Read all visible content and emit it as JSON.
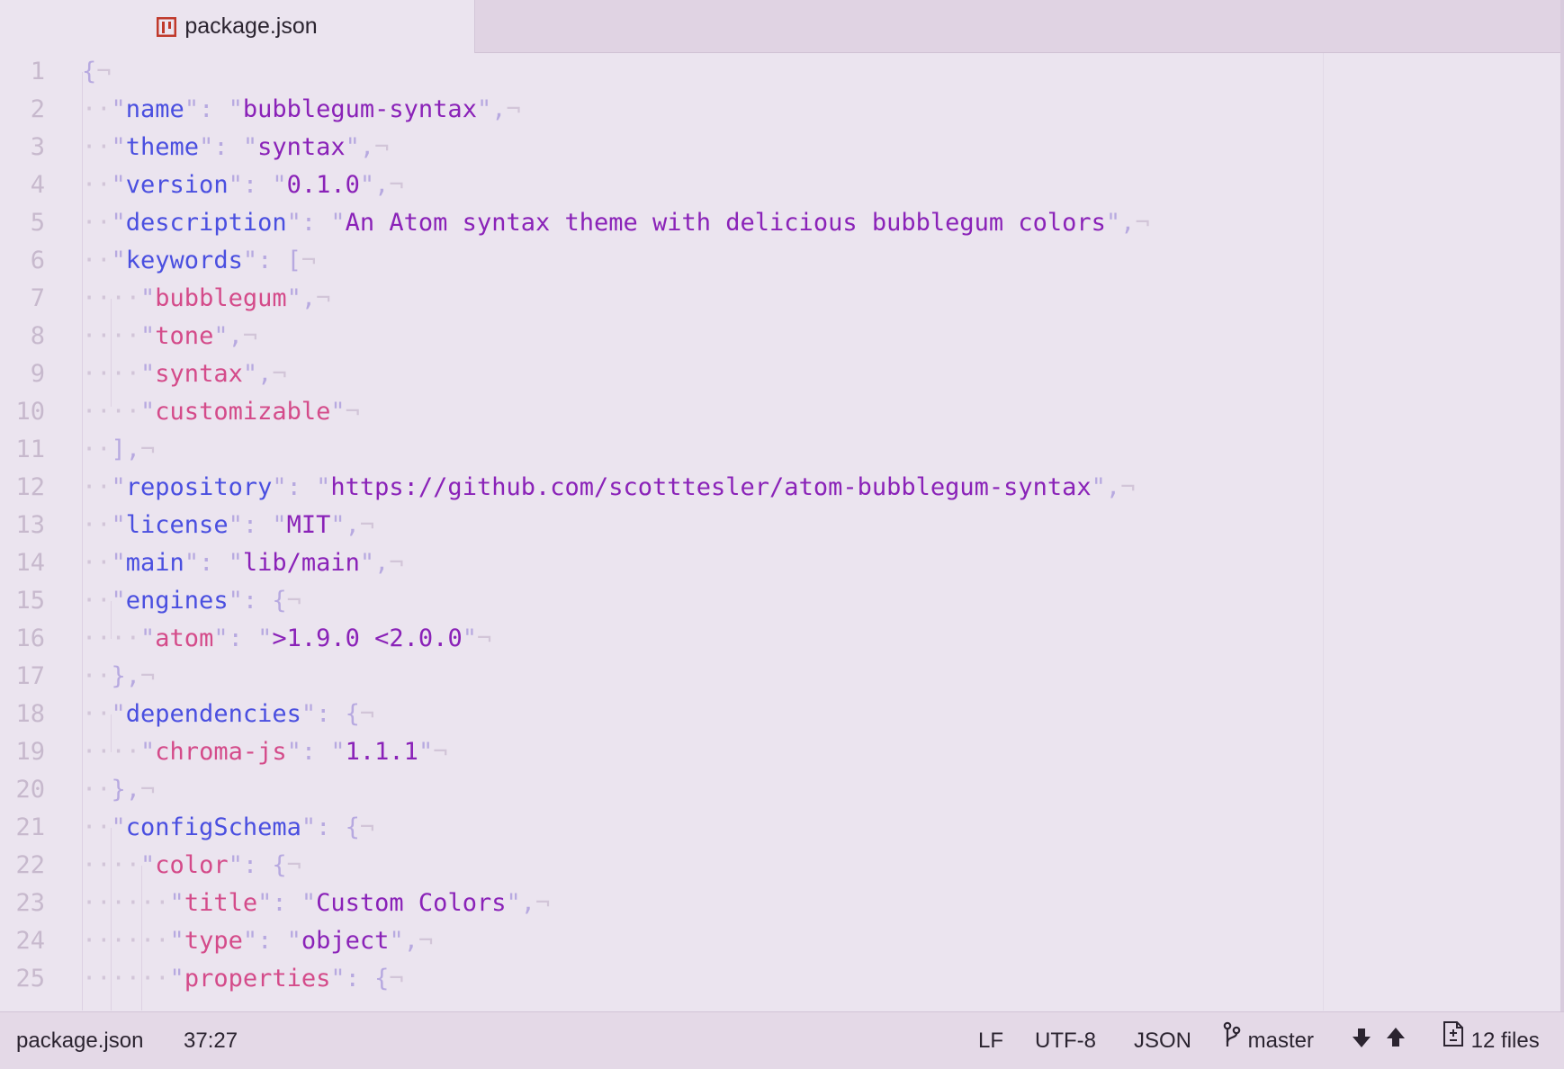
{
  "tab": {
    "title": "package.json",
    "icon": "package-icon",
    "icon_color": "#c0392b"
  },
  "editor": {
    "lines": [
      {
        "n": "1",
        "tokens": [
          [
            "p",
            "{"
          ],
          [
            "g",
            "¬"
          ]
        ]
      },
      {
        "n": "2",
        "tokens": [
          [
            "g",
            "··"
          ],
          [
            "p",
            "\""
          ],
          [
            "k",
            "name"
          ],
          [
            "p",
            "\": "
          ],
          [
            "p",
            "\""
          ],
          [
            "s",
            "bubblegum-syntax"
          ],
          [
            "p",
            "\","
          ],
          [
            "g",
            "¬"
          ]
        ]
      },
      {
        "n": "3",
        "tokens": [
          [
            "g",
            "··"
          ],
          [
            "p",
            "\""
          ],
          [
            "k",
            "theme"
          ],
          [
            "p",
            "\": "
          ],
          [
            "p",
            "\""
          ],
          [
            "s",
            "syntax"
          ],
          [
            "p",
            "\","
          ],
          [
            "g",
            "¬"
          ]
        ]
      },
      {
        "n": "4",
        "tokens": [
          [
            "g",
            "··"
          ],
          [
            "p",
            "\""
          ],
          [
            "k",
            "version"
          ],
          [
            "p",
            "\": "
          ],
          [
            "p",
            "\""
          ],
          [
            "s",
            "0.1.0"
          ],
          [
            "p",
            "\","
          ],
          [
            "g",
            "¬"
          ]
        ]
      },
      {
        "n": "5",
        "tokens": [
          [
            "g",
            "··"
          ],
          [
            "p",
            "\""
          ],
          [
            "k",
            "description"
          ],
          [
            "p",
            "\": "
          ],
          [
            "p",
            "\""
          ],
          [
            "s",
            "An Atom syntax theme with delicious bubblegum colors"
          ],
          [
            "p",
            "\","
          ],
          [
            "g",
            "¬"
          ]
        ]
      },
      {
        "n": "6",
        "tokens": [
          [
            "g",
            "··"
          ],
          [
            "p",
            "\""
          ],
          [
            "k",
            "keywords"
          ],
          [
            "p",
            "\": ["
          ],
          [
            "g",
            "¬"
          ]
        ]
      },
      {
        "n": "7",
        "tokens": [
          [
            "g",
            "····"
          ],
          [
            "p",
            "\""
          ],
          [
            "k2",
            "bubblegum"
          ],
          [
            "p",
            "\","
          ],
          [
            "g",
            "¬"
          ]
        ]
      },
      {
        "n": "8",
        "tokens": [
          [
            "g",
            "····"
          ],
          [
            "p",
            "\""
          ],
          [
            "k2",
            "tone"
          ],
          [
            "p",
            "\","
          ],
          [
            "g",
            "¬"
          ]
        ]
      },
      {
        "n": "9",
        "tokens": [
          [
            "g",
            "····"
          ],
          [
            "p",
            "\""
          ],
          [
            "k2",
            "syntax"
          ],
          [
            "p",
            "\","
          ],
          [
            "g",
            "¬"
          ]
        ]
      },
      {
        "n": "10",
        "tokens": [
          [
            "g",
            "····"
          ],
          [
            "p",
            "\""
          ],
          [
            "k2",
            "customizable"
          ],
          [
            "p",
            "\""
          ],
          [
            "g",
            "¬"
          ]
        ]
      },
      {
        "n": "11",
        "tokens": [
          [
            "g",
            "··"
          ],
          [
            "p",
            "],"
          ],
          [
            "g",
            "¬"
          ]
        ]
      },
      {
        "n": "12",
        "tokens": [
          [
            "g",
            "··"
          ],
          [
            "p",
            "\""
          ],
          [
            "k",
            "repository"
          ],
          [
            "p",
            "\": "
          ],
          [
            "p",
            "\""
          ],
          [
            "s",
            "https://github.com/scotttesler/atom-bubblegum-syntax"
          ],
          [
            "p",
            "\","
          ],
          [
            "g",
            "¬"
          ]
        ]
      },
      {
        "n": "13",
        "tokens": [
          [
            "g",
            "··"
          ],
          [
            "p",
            "\""
          ],
          [
            "k",
            "license"
          ],
          [
            "p",
            "\": "
          ],
          [
            "p",
            "\""
          ],
          [
            "s",
            "MIT"
          ],
          [
            "p",
            "\","
          ],
          [
            "g",
            "¬"
          ]
        ]
      },
      {
        "n": "14",
        "tokens": [
          [
            "g",
            "··"
          ],
          [
            "p",
            "\""
          ],
          [
            "k",
            "main"
          ],
          [
            "p",
            "\": "
          ],
          [
            "p",
            "\""
          ],
          [
            "s",
            "lib/main"
          ],
          [
            "p",
            "\","
          ],
          [
            "g",
            "¬"
          ]
        ]
      },
      {
        "n": "15",
        "tokens": [
          [
            "g",
            "··"
          ],
          [
            "p",
            "\""
          ],
          [
            "k",
            "engines"
          ],
          [
            "p",
            "\": {"
          ],
          [
            "g",
            "¬"
          ]
        ]
      },
      {
        "n": "16",
        "tokens": [
          [
            "g",
            "····"
          ],
          [
            "p",
            "\""
          ],
          [
            "k2",
            "atom"
          ],
          [
            "p",
            "\": "
          ],
          [
            "p",
            "\""
          ],
          [
            "s",
            ">1.9.0 <2.0.0"
          ],
          [
            "p",
            "\""
          ],
          [
            "g",
            "¬"
          ]
        ]
      },
      {
        "n": "17",
        "tokens": [
          [
            "g",
            "··"
          ],
          [
            "p",
            "},"
          ],
          [
            "g",
            "¬"
          ]
        ]
      },
      {
        "n": "18",
        "tokens": [
          [
            "g",
            "··"
          ],
          [
            "p",
            "\""
          ],
          [
            "k",
            "dependencies"
          ],
          [
            "p",
            "\": {"
          ],
          [
            "g",
            "¬"
          ]
        ]
      },
      {
        "n": "19",
        "tokens": [
          [
            "g",
            "····"
          ],
          [
            "p",
            "\""
          ],
          [
            "k2",
            "chroma-js"
          ],
          [
            "p",
            "\": "
          ],
          [
            "p",
            "\""
          ],
          [
            "s",
            "1.1.1"
          ],
          [
            "p",
            "\""
          ],
          [
            "g",
            "¬"
          ]
        ]
      },
      {
        "n": "20",
        "tokens": [
          [
            "g",
            "··"
          ],
          [
            "p",
            "},"
          ],
          [
            "g",
            "¬"
          ]
        ]
      },
      {
        "n": "21",
        "tokens": [
          [
            "g",
            "··"
          ],
          [
            "p",
            "\""
          ],
          [
            "k",
            "configSchema"
          ],
          [
            "p",
            "\": {"
          ],
          [
            "g",
            "¬"
          ]
        ]
      },
      {
        "n": "22",
        "tokens": [
          [
            "g",
            "····"
          ],
          [
            "p",
            "\""
          ],
          [
            "k2",
            "color"
          ],
          [
            "p",
            "\": {"
          ],
          [
            "g",
            "¬"
          ]
        ]
      },
      {
        "n": "23",
        "tokens": [
          [
            "g",
            "······"
          ],
          [
            "p",
            "\""
          ],
          [
            "k2",
            "title"
          ],
          [
            "p",
            "\": "
          ],
          [
            "p",
            "\""
          ],
          [
            "s",
            "Custom Colors"
          ],
          [
            "p",
            "\","
          ],
          [
            "g",
            "¬"
          ]
        ]
      },
      {
        "n": "24",
        "tokens": [
          [
            "g",
            "······"
          ],
          [
            "p",
            "\""
          ],
          [
            "k2",
            "type"
          ],
          [
            "p",
            "\": "
          ],
          [
            "p",
            "\""
          ],
          [
            "s",
            "object"
          ],
          [
            "p",
            "\","
          ],
          [
            "g",
            "¬"
          ]
        ]
      },
      {
        "n": "25",
        "tokens": [
          [
            "g",
            "······"
          ],
          [
            "p",
            "\""
          ],
          [
            "k2",
            "properties"
          ],
          [
            "p",
            "\": {"
          ],
          [
            "g",
            "¬"
          ]
        ]
      }
    ]
  },
  "status": {
    "filename": "package.json",
    "cursor": "37:27",
    "line_ending": "LF",
    "encoding": "UTF-8",
    "grammar": "JSON",
    "branch": "master",
    "files": "12 files"
  }
}
